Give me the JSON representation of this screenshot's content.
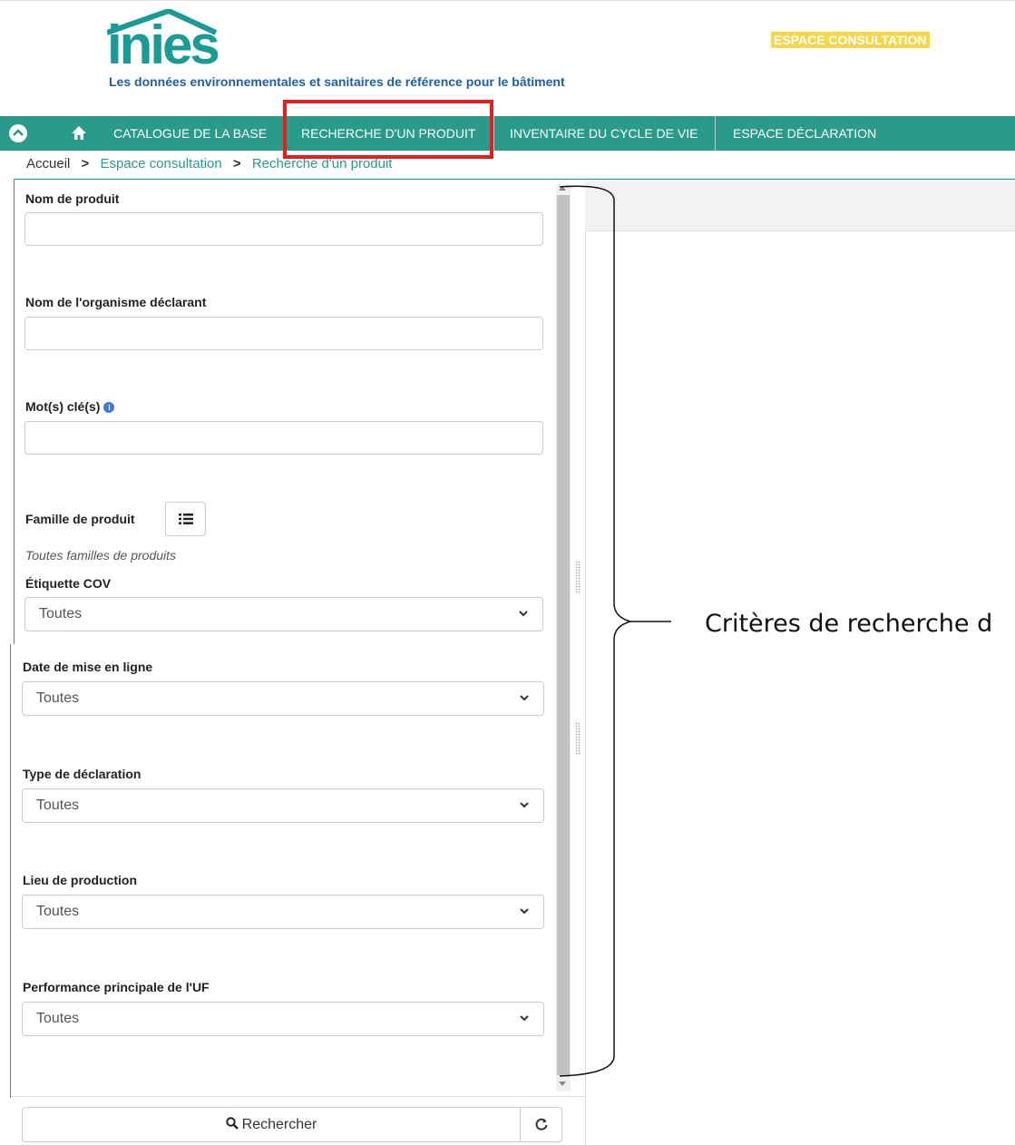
{
  "header": {
    "logo_text": "inies",
    "tagline": "Les données environnementales et sanitaires de référence pour le bâtiment",
    "space_badge": "ESPACE CONSULTATION"
  },
  "nav": {
    "items": [
      {
        "label": "CATALOGUE DE LA BASE"
      },
      {
        "label": "RECHERCHE D'UN PRODUIT"
      },
      {
        "label": "INVENTAIRE DU CYCLE DE VIE"
      },
      {
        "label": "ESPACE DÉCLARATION"
      }
    ]
  },
  "breadcrumb": {
    "home": "Accueil",
    "consultation": "Espace consultation",
    "current": "Recherche d'un produit",
    "separator": ">"
  },
  "form": {
    "product_name_label": "Nom de produit",
    "organism_label": "Nom de l'organisme déclarant",
    "keywords_label": "Mot(s) clé(s)",
    "family_label": "Famille de produit",
    "family_hint": "Toutes familles de produits",
    "cov_label": "Étiquette COV",
    "cov_value": "Toutes",
    "date_label": "Date de mise en ligne",
    "date_value": "Toutes",
    "type_label": "Type de déclaration",
    "type_value": "Toutes",
    "lieu_label": "Lieu de production",
    "lieu_value": "Toutes",
    "perf_label": "Performance principale de l'UF",
    "perf_value": "Toutes",
    "search_button": "Rechercher"
  },
  "annotation": "Critères de recherche d",
  "colors": {
    "nav_bg": "#2a9a8a",
    "brand_teal": "#1b9b96",
    "tagline_blue": "#1f5fa6",
    "badge_yellow": "#f6d64a",
    "highlight_red": "#e81e1e"
  }
}
